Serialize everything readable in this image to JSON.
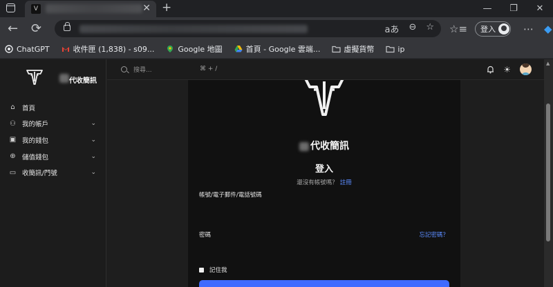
{
  "browser": {
    "tab": {
      "favicon_letter": "V",
      "close": "✕"
    },
    "new_tab": "+",
    "window_controls": [
      "—",
      "❐",
      "✕"
    ],
    "nav": {
      "back": "←",
      "reload": "⟳"
    },
    "omnibox_icons": [
      "aあ",
      "⊖",
      "☆"
    ],
    "toolbar_icons": {
      "favorites": "☆≡",
      "more": "⋯",
      "copilot": "◆"
    },
    "profile": {
      "label": "登入"
    },
    "bookmarks": [
      {
        "label": "ChatGPT",
        "icon": "chatgpt-icon",
        "color": "#e8eaed"
      },
      {
        "label": "收件匣 (1,838) - s09...",
        "icon": "gmail-icon",
        "color": "#ea4335"
      },
      {
        "label": "Google 地圖",
        "icon": "maps-icon",
        "color": "#34a853"
      },
      {
        "label": "首頁 - Google 雲端...",
        "icon": "drive-icon",
        "color": "#fbbc04"
      },
      {
        "label": "虛擬貨幣",
        "icon": "folder-icon",
        "color": "#c5c7ca"
      },
      {
        "label": "ip",
        "icon": "folder-icon",
        "color": "#c5c7ca"
      }
    ]
  },
  "site": {
    "brand": {
      "name": "代收簡訊"
    },
    "menu": [
      {
        "label": "首頁",
        "icon": "home-icon",
        "glyph": "⌂",
        "has_chevron": false
      },
      {
        "label": "我的帳戶",
        "icon": "user-icon",
        "glyph": "⚇",
        "has_chevron": true
      },
      {
        "label": "我的錢包",
        "icon": "wallet-icon",
        "glyph": "▣",
        "has_chevron": true
      },
      {
        "label": "儲值錢包",
        "icon": "plus-circle-icon",
        "glyph": "⊕",
        "has_chevron": true
      },
      {
        "label": "收簡訊/門號",
        "icon": "message-icon",
        "glyph": "▭",
        "has_chevron": true
      }
    ],
    "chevron": "⌄",
    "header": {
      "search_placeholder": "搜尋...",
      "shortcut": "⌘ + /",
      "bell": "🔔",
      "sun": "☀"
    },
    "login": {
      "brand": "代收簡訊",
      "title": "登入",
      "no_account": "還沒有帳號嗎？",
      "register": "註冊",
      "account_label": "帳號/電子郵件/電話號碼",
      "password_label": "密碼",
      "forgot": "忘記密碼？",
      "remember": "記住我"
    },
    "accent_color": "#3f6bff"
  }
}
